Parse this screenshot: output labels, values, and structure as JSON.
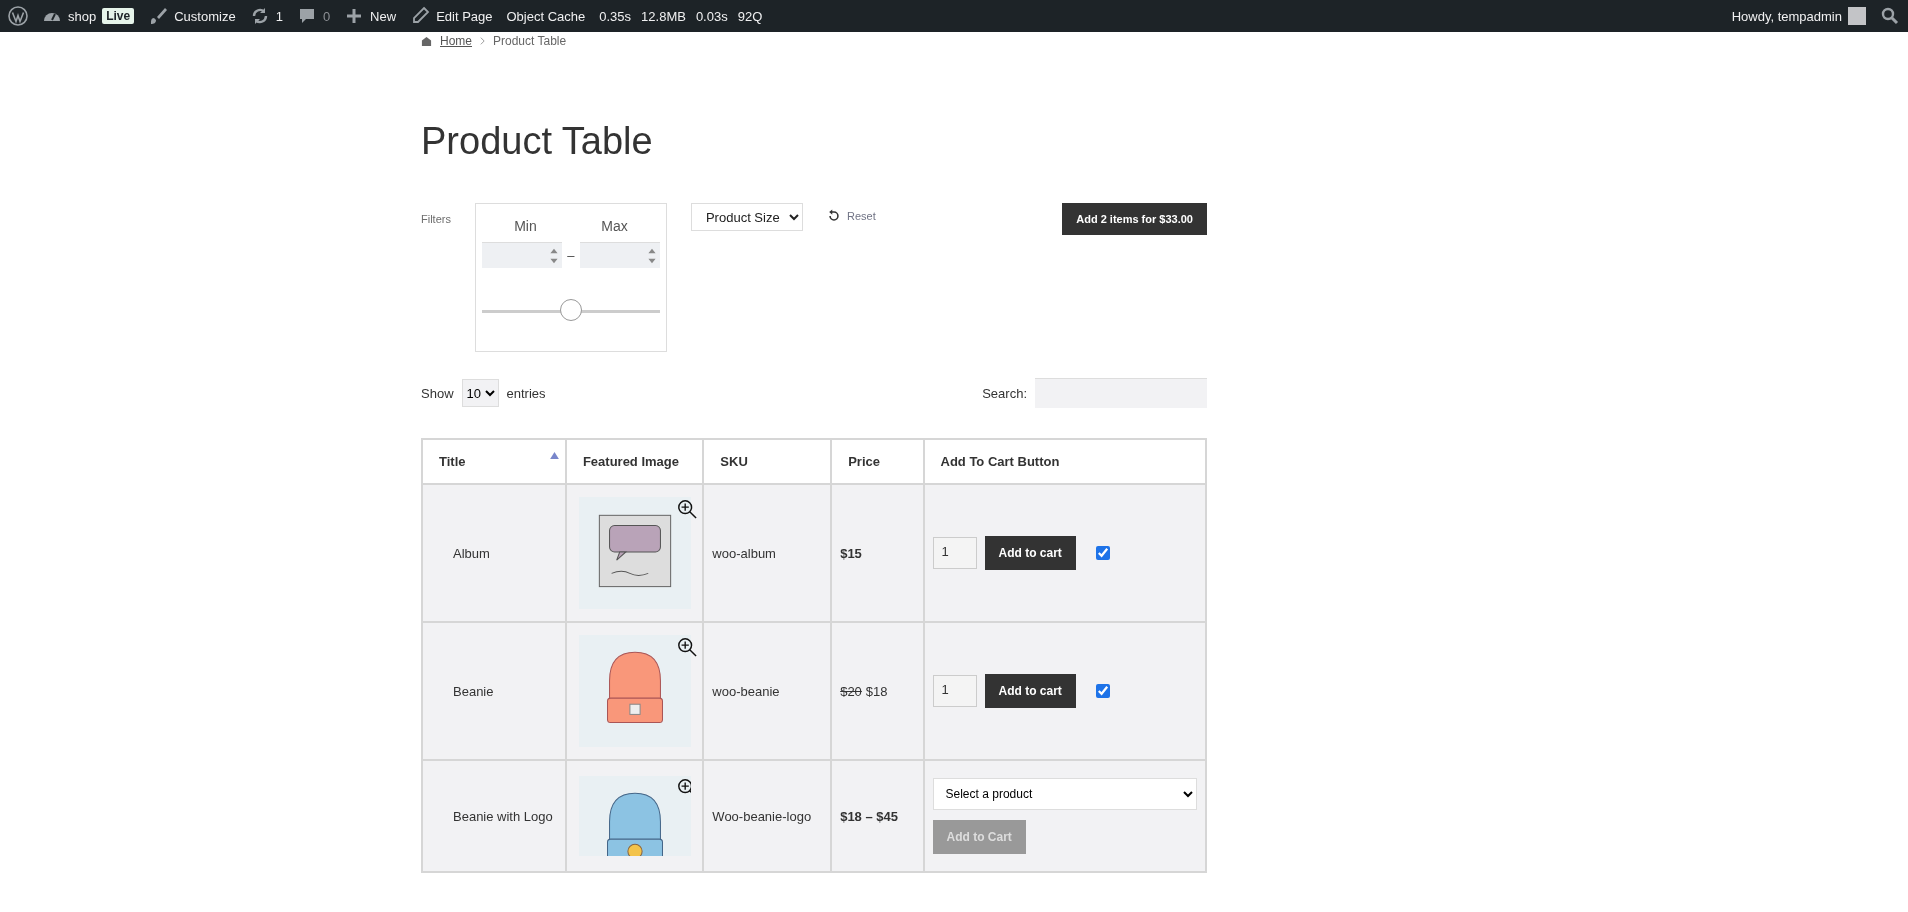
{
  "admin_bar": {
    "site": "shop",
    "live_badge": "Live",
    "customize": "Customize",
    "updates": "1",
    "comments": "0",
    "new": "New",
    "edit_page": "Edit Page",
    "object_cache": "Object Cache",
    "stats": [
      "0.35s",
      "12.8MB",
      "0.03s",
      "92Q"
    ],
    "howdy": "Howdy, tempadmin"
  },
  "breadcrumb": [
    "Home",
    "Product Table"
  ],
  "title": "Product Table",
  "filters": {
    "label": "Filters",
    "min_label": "Min",
    "max_label": "Max",
    "separator": "–",
    "range": {
      "level": 0.5
    },
    "size_select": "Product Size",
    "reset": "Reset"
  },
  "add_selected_button": "Add 2 items for $33.00",
  "show_entries": {
    "show": "Show",
    "value": "10",
    "entries": "entries"
  },
  "search": {
    "label": "Search:"
  },
  "table": {
    "columns": [
      {
        "label": "Title",
        "sorted": true
      },
      {
        "label": "Featured Image",
        "sorted": false
      },
      {
        "label": "SKU",
        "sorted": false
      },
      {
        "label": "Price",
        "sorted": false
      },
      {
        "label": "Add To Cart Button",
        "sorted": false
      }
    ],
    "rows": [
      {
        "title": "Album",
        "image": {
          "kind": "album"
        },
        "sku": "woo-album",
        "price": "$15",
        "cart": {
          "kind": "simple",
          "quantity": "1",
          "button": "Add to cart",
          "checked": true
        }
      },
      {
        "title": "Beanie",
        "image": {
          "kind": "beanie"
        },
        "sku": "woo-beanie",
        "old_price": "$20",
        "price": "$18",
        "cart": {
          "kind": "simple",
          "quantity": "1",
          "button": "Add to cart",
          "checked": true
        }
      },
      {
        "title": "Beanie with Logo",
        "image": {
          "kind": "beanie_logo"
        },
        "sku": "Woo-beanie-logo",
        "price": "$18 – $45",
        "cart": {
          "kind": "variable",
          "select": "Select a product",
          "button": "Add to Cart",
          "disabled": true
        }
      }
    ]
  }
}
